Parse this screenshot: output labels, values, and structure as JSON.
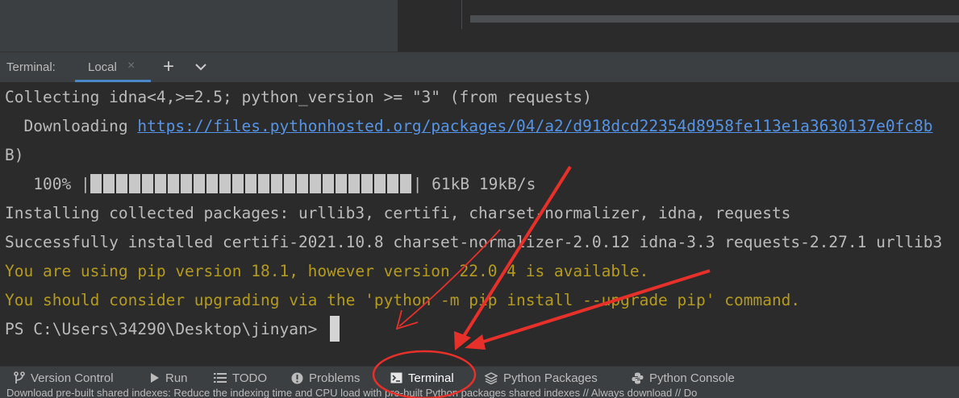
{
  "tool_window": {
    "title": "Terminal:",
    "tab_label": "Local",
    "tab_close": "×",
    "add_tab": "+"
  },
  "terminal": {
    "line1": "Collecting idna<4,>=2.5; python_version >= \"3\" (from requests)",
    "line2_prefix": "  Downloading ",
    "line2_link": "https://files.pythonhosted.org/packages/04/a2/d918dcd22354d8958fe113e1a3630137e0fc8b",
    "line3": "B)",
    "progress_percent": "100%",
    "progress_value": 1.0,
    "progress_pipe_left": " |",
    "progress_pipe_right": "|",
    "progress_stats": " 61kB 19kB/s",
    "line5": "Installing collected packages: urllib3, certifi, charset-normalizer, idna, requests",
    "line6": "Successfully installed certifi-2021.10.8 charset-normalizer-2.0.12 idna-3.3 requests-2.27.1 urllib3",
    "line7": "You are using pip version 18.1, however version 22.0.4 is available.",
    "line8": "You should consider upgrading via the 'python -m pip install --upgrade pip' command.",
    "prompt": "PS C:\\Users\\34290\\Desktop\\jinyan> "
  },
  "bottom_tabs": {
    "version_control": "Version Control",
    "run": "Run",
    "todo": "TODO",
    "problems": "Problems",
    "terminal": "Terminal",
    "python_packages": "Python Packages",
    "python_console": "Python Console"
  },
  "status_text": "Download pre-built shared indexes: Reduce the indexing time and CPU load with pre-built Python packages shared indexes // Always download // Do",
  "colors": {
    "background": "#2b2b2b",
    "panel": "#3c3f41",
    "text": "#bbbbbb",
    "warning": "#b59b1d",
    "link": "#5594e6",
    "annotation": "#e8302a",
    "tab_underline": "#4a88c7"
  },
  "icons": {
    "version_control": "branch-icon",
    "run": "play-icon",
    "todo": "list-icon",
    "problems": "info-icon",
    "terminal": "terminal-icon",
    "python_packages": "layers-icon",
    "python_console": "python-icon"
  }
}
